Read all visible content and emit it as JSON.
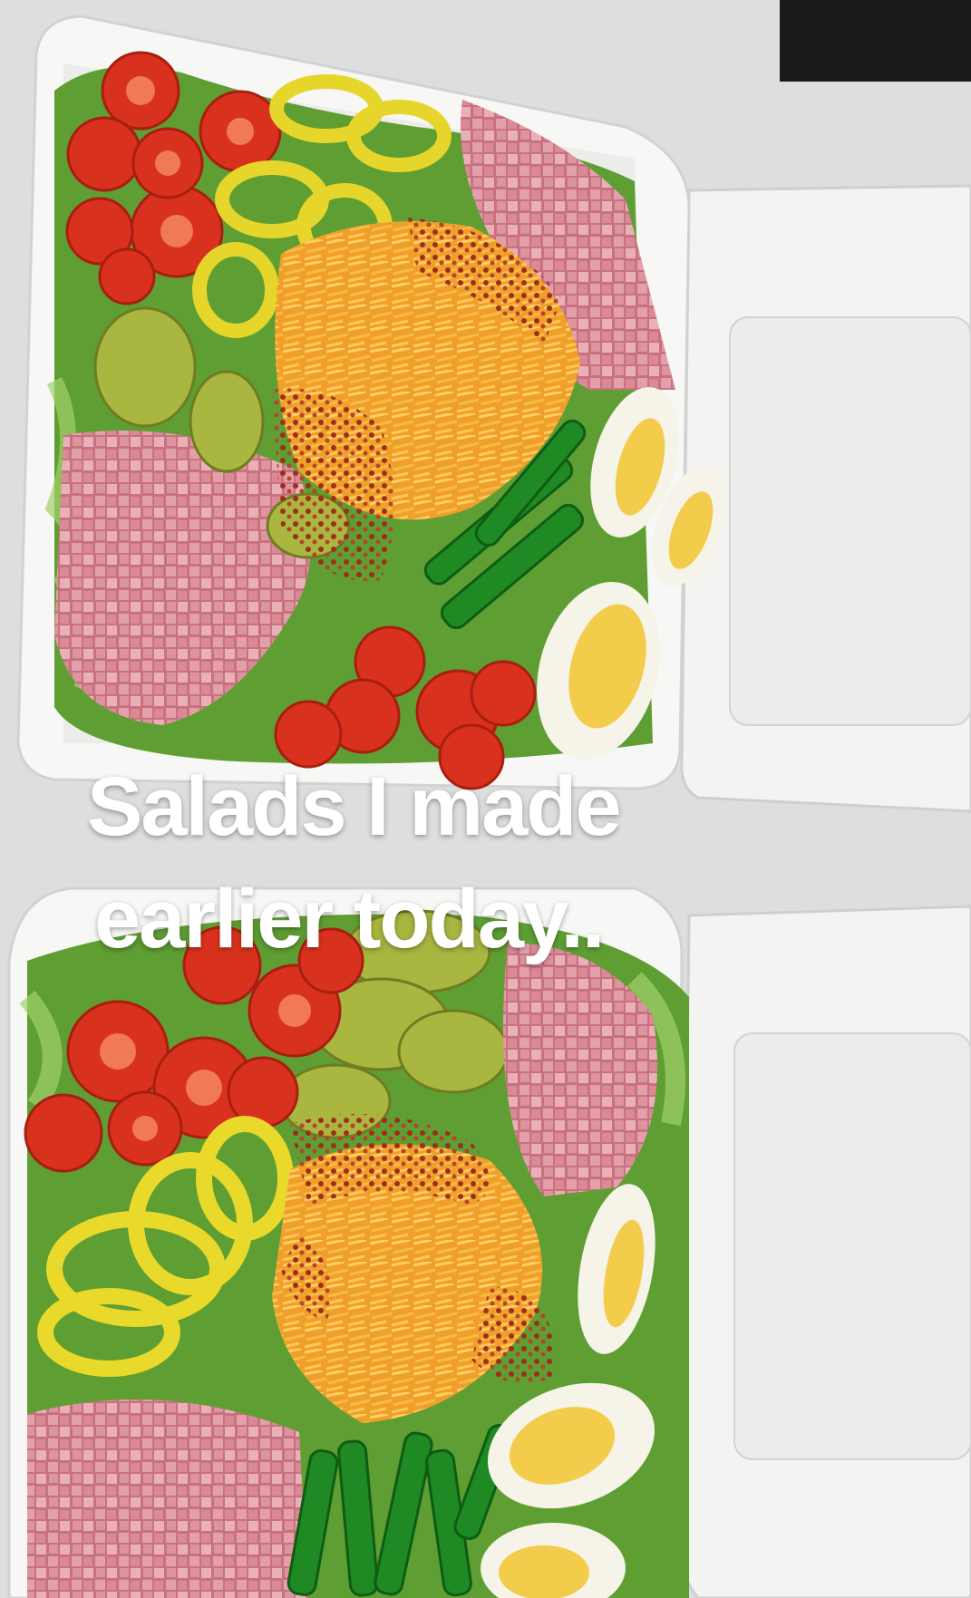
{
  "caption": {
    "line1": "Salads I made",
    "line2": "earlier today.."
  },
  "colors": {
    "background": "#dcdcdc",
    "container": "#f4f4f2",
    "lettuce": "#6aa83a",
    "tomato": "#d8321e",
    "pepperoncini": "#e9d92b",
    "ham": "#d9909a",
    "cheddar": "#f2a531",
    "bacon_bits": "#9e2e1c",
    "green_pepper": "#1f8a24",
    "egg_white": "#f6f3e8",
    "egg_yolk": "#f2cc4a",
    "pickle": "#a9b640"
  }
}
